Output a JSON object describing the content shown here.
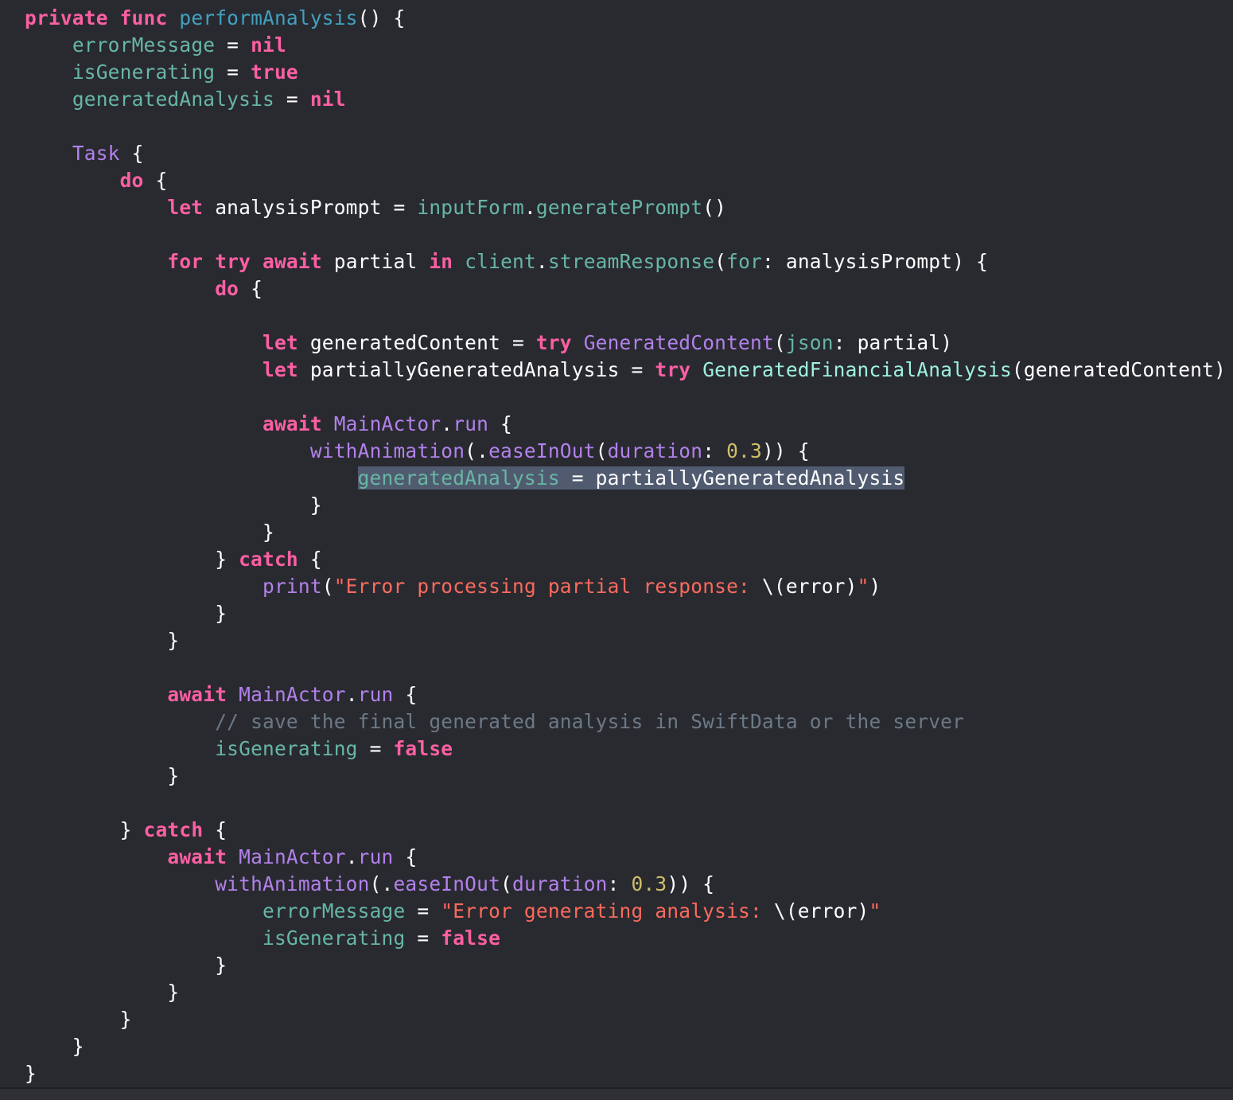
{
  "editor": {
    "language": "Swift",
    "theme_background": "#292a30",
    "selection_color": "#515b70",
    "lines": [
      [
        [
          "k",
          "private"
        ],
        [
          "p",
          " "
        ],
        [
          "k",
          "func"
        ],
        [
          "p",
          " "
        ],
        [
          "fd",
          "performAnalysis"
        ],
        [
          "p",
          "() {"
        ]
      ],
      [
        [
          "p",
          "    "
        ],
        [
          "f",
          "errorMessage"
        ],
        [
          "p",
          " = "
        ],
        [
          "k",
          "nil"
        ]
      ],
      [
        [
          "p",
          "    "
        ],
        [
          "f",
          "isGenerating"
        ],
        [
          "p",
          " = "
        ],
        [
          "k",
          "true"
        ]
      ],
      [
        [
          "p",
          "    "
        ],
        [
          "f",
          "generatedAnalysis"
        ],
        [
          "p",
          " = "
        ],
        [
          "k",
          "nil"
        ]
      ],
      [],
      [
        [
          "p",
          "    "
        ],
        [
          "on",
          "Task"
        ],
        [
          "p",
          " {"
        ]
      ],
      [
        [
          "p",
          "        "
        ],
        [
          "k",
          "do"
        ],
        [
          "p",
          " {"
        ]
      ],
      [
        [
          "p",
          "            "
        ],
        [
          "k",
          "let"
        ],
        [
          "p",
          " analysisPrompt = "
        ],
        [
          "f",
          "inputForm"
        ],
        [
          "p",
          "."
        ],
        [
          "f",
          "generatePrompt"
        ],
        [
          "p",
          "()"
        ]
      ],
      [],
      [
        [
          "p",
          "            "
        ],
        [
          "k",
          "for"
        ],
        [
          "p",
          " "
        ],
        [
          "k",
          "try"
        ],
        [
          "p",
          " "
        ],
        [
          "k",
          "await"
        ],
        [
          "p",
          " partial "
        ],
        [
          "k",
          "in"
        ],
        [
          "p",
          " "
        ],
        [
          "f",
          "client"
        ],
        [
          "p",
          "."
        ],
        [
          "f",
          "streamResponse"
        ],
        [
          "p",
          "("
        ],
        [
          "f",
          "for"
        ],
        [
          "p",
          ": analysisPrompt) {"
        ]
      ],
      [
        [
          "p",
          "                "
        ],
        [
          "k",
          "do"
        ],
        [
          "p",
          " {"
        ]
      ],
      [],
      [
        [
          "p",
          "                    "
        ],
        [
          "k",
          "let"
        ],
        [
          "p",
          " generatedContent = "
        ],
        [
          "k",
          "try"
        ],
        [
          "p",
          " "
        ],
        [
          "on",
          "GeneratedContent"
        ],
        [
          "p",
          "("
        ],
        [
          "f",
          "json"
        ],
        [
          "p",
          ": partial)"
        ]
      ],
      [
        [
          "p",
          "                    "
        ],
        [
          "k",
          "let"
        ],
        [
          "p",
          " partiallyGeneratedAnalysis = "
        ],
        [
          "k",
          "try"
        ],
        [
          "p",
          " "
        ],
        [
          "tp",
          "GeneratedFinancialAnalysis"
        ],
        [
          "p",
          "(generatedContent)"
        ]
      ],
      [],
      [
        [
          "p",
          "                    "
        ],
        [
          "k",
          "await"
        ],
        [
          "p",
          " "
        ],
        [
          "on",
          "MainActor"
        ],
        [
          "p",
          "."
        ],
        [
          "on",
          "run"
        ],
        [
          "p",
          " {"
        ]
      ],
      [
        [
          "p",
          "                        "
        ],
        [
          "on",
          "withAnimation"
        ],
        [
          "p",
          "(."
        ],
        [
          "on",
          "easeInOut"
        ],
        [
          "p",
          "("
        ],
        [
          "on",
          "duration"
        ],
        [
          "p",
          ": "
        ],
        [
          "n",
          "0.3"
        ],
        [
          "p",
          ")) {"
        ]
      ],
      [
        [
          "p",
          "                            "
        ],
        [
          "hl",
          [
            [
              "f",
              "generatedAnalysis"
            ],
            [
              "p",
              " = partiallyGeneratedAnalysis"
            ]
          ]
        ]
      ],
      [
        [
          "p",
          "                        }"
        ]
      ],
      [
        [
          "p",
          "                    }"
        ]
      ],
      [
        [
          "p",
          "                } "
        ],
        [
          "k",
          "catch"
        ],
        [
          "p",
          " {"
        ]
      ],
      [
        [
          "p",
          "                    "
        ],
        [
          "on",
          "print"
        ],
        [
          "p",
          "("
        ],
        [
          "s",
          "\"Error processing partial response: "
        ],
        [
          "p",
          "\\(error)"
        ],
        [
          "s",
          "\""
        ],
        [
          "p",
          ")"
        ]
      ],
      [
        [
          "p",
          "                }"
        ]
      ],
      [
        [
          "p",
          "            }"
        ]
      ],
      [],
      [
        [
          "p",
          "            "
        ],
        [
          "k",
          "await"
        ],
        [
          "p",
          " "
        ],
        [
          "on",
          "MainActor"
        ],
        [
          "p",
          "."
        ],
        [
          "on",
          "run"
        ],
        [
          "p",
          " {"
        ]
      ],
      [
        [
          "p",
          "                "
        ],
        [
          "c",
          "// save the final generated analysis in SwiftData or the server"
        ]
      ],
      [
        [
          "p",
          "                "
        ],
        [
          "f",
          "isGenerating"
        ],
        [
          "p",
          " = "
        ],
        [
          "k",
          "false"
        ]
      ],
      [
        [
          "p",
          "            }"
        ]
      ],
      [],
      [
        [
          "p",
          "        } "
        ],
        [
          "k",
          "catch"
        ],
        [
          "p",
          " {"
        ]
      ],
      [
        [
          "p",
          "            "
        ],
        [
          "k",
          "await"
        ],
        [
          "p",
          " "
        ],
        [
          "on",
          "MainActor"
        ],
        [
          "p",
          "."
        ],
        [
          "on",
          "run"
        ],
        [
          "p",
          " {"
        ]
      ],
      [
        [
          "p",
          "                "
        ],
        [
          "on",
          "withAnimation"
        ],
        [
          "p",
          "(."
        ],
        [
          "on",
          "easeInOut"
        ],
        [
          "p",
          "("
        ],
        [
          "on",
          "duration"
        ],
        [
          "p",
          ": "
        ],
        [
          "n",
          "0.3"
        ],
        [
          "p",
          ")) {"
        ]
      ],
      [
        [
          "p",
          "                    "
        ],
        [
          "f",
          "errorMessage"
        ],
        [
          "p",
          " = "
        ],
        [
          "s",
          "\"Error generating analysis: "
        ],
        [
          "p",
          "\\(error)"
        ],
        [
          "s",
          "\""
        ]
      ],
      [
        [
          "p",
          "                    "
        ],
        [
          "f",
          "isGenerating"
        ],
        [
          "p",
          " = "
        ],
        [
          "k",
          "false"
        ]
      ],
      [
        [
          "p",
          "                }"
        ]
      ],
      [
        [
          "p",
          "            }"
        ]
      ],
      [
        [
          "p",
          "        }"
        ]
      ],
      [
        [
          "p",
          "    }"
        ]
      ],
      [
        [
          "p",
          "}"
        ]
      ]
    ]
  }
}
